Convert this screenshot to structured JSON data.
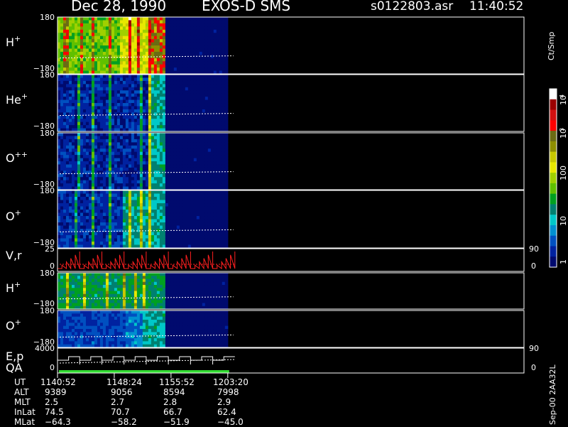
{
  "header": {
    "date": "Dec 28, 1990",
    "instrument": "EXOS-D SMS",
    "file": "s0122803.asr",
    "time": "11:40:52"
  },
  "colors": {
    "background": "#000000",
    "frame": "#ffffff",
    "cold": "#000a6e",
    "trace_red": "#ff2020",
    "flag_green": "#33dd33"
  },
  "colorbar": {
    "title": "Ct/Smp",
    "ticks": [
      "1",
      "10",
      "100",
      "10",
      "10"
    ],
    "exponents": [
      "3",
      "4"
    ],
    "stops": [
      "#ffffff",
      "#9a0000",
      "#d01010",
      "#ff0000",
      "#6b6b14",
      "#8e8e00",
      "#c8c800",
      "#e8e800",
      "#a0d000",
      "#60c000",
      "#00a020",
      "#008070",
      "#00c8c8",
      "#0090d0",
      "#0050c0",
      "#0022a0",
      "#000a6e"
    ]
  },
  "left_labels": [
    {
      "id": "panel1",
      "name": "H",
      "sup": "+",
      "top_tick": "180",
      "bottom_tick": "−180"
    },
    {
      "id": "panel2",
      "name": "He",
      "sup": "+",
      "top_tick": "180",
      "bottom_tick": "−180"
    },
    {
      "id": "panel3",
      "name": "O",
      "sup": "++",
      "top_tick": "180",
      "bottom_tick": "−180"
    },
    {
      "id": "panel4",
      "name": "O",
      "sup": "+",
      "top_tick": "180",
      "bottom_tick": "−180"
    },
    {
      "id": "panel5",
      "name": "V,r",
      "sup": "",
      "top_tick": "25",
      "bottom_tick": "0",
      "right_top": "90",
      "right_bottom": "0"
    },
    {
      "id": "panel6",
      "name": "H",
      "sup": "+",
      "top_tick": "180",
      "bottom_tick": "−180"
    },
    {
      "id": "panel7",
      "name": "O",
      "sup": "+",
      "top_tick": "180",
      "bottom_tick": "−180"
    },
    {
      "id": "panel8",
      "name": "E,p",
      "name2": "QA",
      "sup": "",
      "top_tick": "4000",
      "bottom_tick": "0",
      "right_top": "90",
      "right_bottom": "0"
    }
  ],
  "ephemeris": {
    "labels": [
      "UT",
      "ALT",
      "MLT",
      "InLat",
      "MLat"
    ],
    "columns": [
      [
        "1140:52",
        "9389",
        "2.5",
        "74.5",
        "−64.3"
      ],
      [
        "1148:24",
        "9056",
        "2.7",
        "70.7",
        "−58.2"
      ],
      [
        "1155:52",
        "8594",
        "2.8",
        "66.7",
        "−51.9"
      ],
      [
        "1203:20",
        "7998",
        "2.9",
        "62.4",
        "−45.0"
      ]
    ]
  },
  "side_note": "Sep-00 2AA32L",
  "chart_data": {
    "type": "heatmap",
    "x": [
      "1140:52",
      "1148:24",
      "1155:52",
      "1203:20"
    ],
    "x_fraction_with_data": 0.365,
    "panels": [
      {
        "name": "H+",
        "ylim": [
          -180,
          180
        ],
        "level_bands": [
          [
            0.0,
            0.36,
            0.45
          ],
          [
            0.36,
            0.55,
            0.55
          ],
          [
            0.55,
            0.62,
            0.78
          ],
          [
            0.62,
            1.0,
            0.0
          ]
        ],
        "peaks": [
          0.04,
          0.13,
          0.2,
          0.3,
          0.42,
          0.47,
          0.53
        ]
      },
      {
        "name": "He+",
        "ylim": [
          -180,
          180
        ],
        "level_bands": [
          [
            0.0,
            0.53,
            0.08
          ],
          [
            0.53,
            0.62,
            0.3
          ],
          [
            0.62,
            1.0,
            0.0
          ]
        ],
        "peaks": [
          0.12,
          0.2,
          0.3,
          0.48,
          0.53
        ]
      },
      {
        "name": "O++",
        "ylim": [
          -180,
          180
        ],
        "level_bands": [
          [
            0.0,
            0.53,
            0.08
          ],
          [
            0.53,
            0.62,
            0.3
          ],
          [
            0.62,
            1.0,
            0.0
          ]
        ],
        "peaks": [
          0.12,
          0.2,
          0.3,
          0.48,
          0.53
        ]
      },
      {
        "name": "O+",
        "ylim": [
          -180,
          180
        ],
        "level_bands": [
          [
            0.0,
            0.38,
            0.1
          ],
          [
            0.38,
            0.62,
            0.3
          ],
          [
            0.62,
            1.0,
            0.0
          ]
        ],
        "peaks": [
          0.1,
          0.2,
          0.3,
          0.42,
          0.48,
          0.53
        ]
      },
      {
        "name": "V,r",
        "ylim": [
          0,
          25
        ],
        "y2lim": [
          0,
          90
        ],
        "sawtooth_count": 8
      },
      {
        "name": "H+",
        "ylim": [
          -180,
          180
        ],
        "level_bands": [
          [
            0.0,
            0.62,
            0.35
          ],
          [
            0.62,
            1.0,
            0.0
          ]
        ],
        "peaks": [
          0.05,
          0.15,
          0.28,
          0.38,
          0.45,
          0.5
        ]
      },
      {
        "name": "O+",
        "ylim": [
          -180,
          180
        ],
        "level_bands": [
          [
            0.0,
            0.4,
            0.12
          ],
          [
            0.4,
            0.5,
            0.18
          ],
          [
            0.5,
            0.62,
            0.3
          ],
          [
            0.62,
            1.0,
            0.0
          ]
        ],
        "peaks": []
      },
      {
        "name": "E,p",
        "ylim": [
          0,
          4000
        ],
        "y2lim": [
          0,
          90
        ],
        "staircase_steps": 8
      }
    ]
  }
}
